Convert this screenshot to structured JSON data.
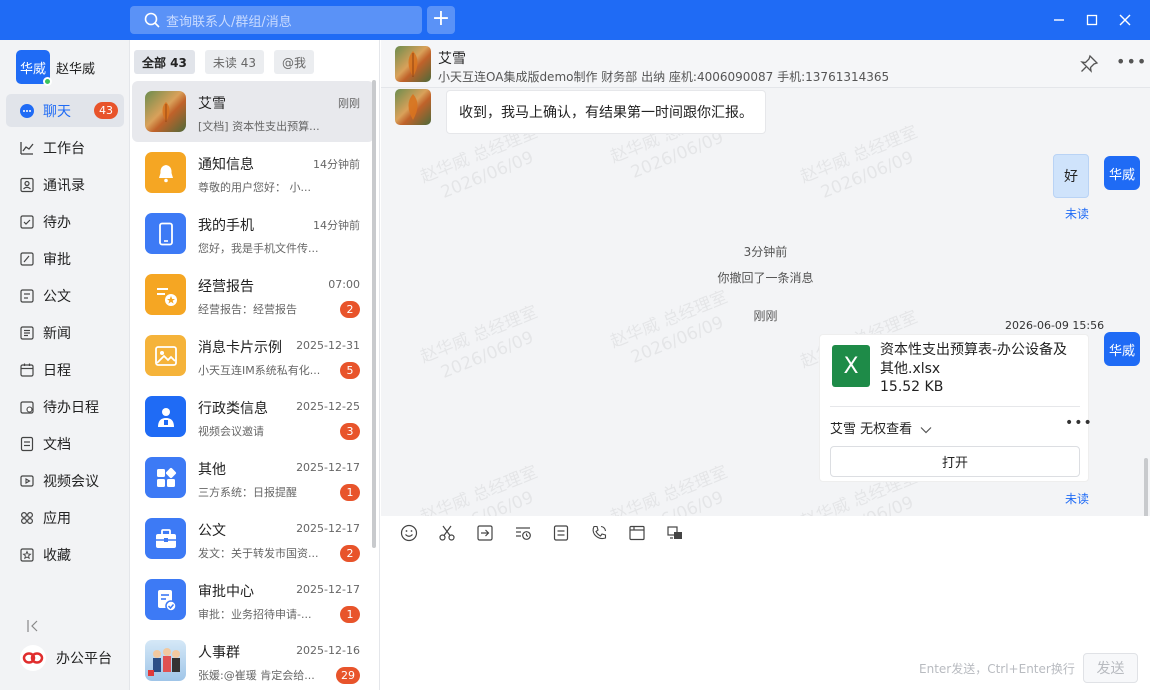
{
  "titlebar": {
    "search_placeholder": "查询联系人/群组/消息",
    "add_label": "+"
  },
  "user": {
    "avatar_text": "华威",
    "name": "赵华威"
  },
  "nav": {
    "items": [
      {
        "label": "聊天",
        "badge": "43",
        "icon": "chat-icon"
      },
      {
        "label": "工作台",
        "icon": "workbench-icon"
      },
      {
        "label": "通讯录",
        "icon": "contacts-icon"
      },
      {
        "label": "待办",
        "icon": "todo-icon"
      },
      {
        "label": "审批",
        "icon": "approval-icon"
      },
      {
        "label": "公文",
        "icon": "document-icon"
      },
      {
        "label": "新闻",
        "icon": "news-icon"
      },
      {
        "label": "日程",
        "icon": "calendar-icon"
      },
      {
        "label": "待办日程",
        "icon": "todo-calendar-icon"
      },
      {
        "label": "文档",
        "icon": "docs-icon"
      },
      {
        "label": "视频会议",
        "icon": "video-icon"
      },
      {
        "label": "应用",
        "icon": "apps-icon"
      },
      {
        "label": "收藏",
        "icon": "star-icon"
      }
    ],
    "platform_label": "办公平台"
  },
  "tabs": [
    {
      "label": "全部 43"
    },
    {
      "label": "未读 43"
    },
    {
      "label": "@我"
    }
  ],
  "conversations": [
    {
      "name": "艾雪",
      "time": "刚刚",
      "preview": "[文档] 资本性支出预算...",
      "badge": "",
      "icon": "leaf-photo-avatar",
      "color": "#c87a2a"
    },
    {
      "name": "通知信息",
      "time": "14分钟前",
      "preview": "尊敬的用户您好：  小...",
      "badge": "",
      "icon": "bell-icon",
      "color": "#f5a623"
    },
    {
      "name": "我的手机",
      "time": "14分钟前",
      "preview": "您好，我是手机文件传...",
      "badge": "",
      "icon": "phone-icon",
      "color": "#3d7af5"
    },
    {
      "name": "经营报告",
      "time": "07:00",
      "preview": "经营报告：经营报告",
      "badge": "2",
      "icon": "report-icon",
      "color": "#f5a623"
    },
    {
      "name": "消息卡片示例",
      "time": "2025-12-31",
      "preview": "小天互连IM系统私有化...",
      "badge": "5",
      "icon": "image-card-icon",
      "color": "#f5b33a"
    },
    {
      "name": "行政类信息",
      "time": "2025-12-25",
      "preview": "视频会议邀请",
      "badge": "3",
      "icon": "meeting-icon",
      "color": "#1f6bf5"
    },
    {
      "name": "其他",
      "time": "2025-12-17",
      "preview": "三方系统：日报提醒",
      "badge": "1",
      "icon": "grid-icon",
      "color": "#3d7af5"
    },
    {
      "name": "公文",
      "time": "2025-12-17",
      "preview": "发文：关于转发市国资...",
      "badge": "2",
      "icon": "briefcase-icon",
      "color": "#3d7af5"
    },
    {
      "name": "审批中心",
      "time": "2025-12-17",
      "preview": "审批：业务招待申请-...",
      "badge": "1",
      "icon": "approval-center-icon",
      "color": "#3d7af5"
    },
    {
      "name": "人事群",
      "time": "2025-12-16",
      "preview": "张媛:@崔瑗 肯定会给...",
      "badge": "29",
      "icon": "group-photo-avatar",
      "color": "#7fb3e0"
    }
  ],
  "chat": {
    "name": "艾雪",
    "info": "小天互连OA集成版demo制作 财务部 出纳 座机:4006090087 手机:13761314365",
    "watermark_name": "赵华威 总经理室",
    "watermark_date": "2026/06/09",
    "incoming_text": "收到，我马上确认，有结果第一时间跟你汇报。",
    "my_avatar_text": "华威",
    "outgoing_text": "好",
    "unread_label": "未读",
    "sys1": "3分钟前",
    "sys2": "你撤回了一条消息",
    "sys3": "刚刚",
    "file_time": "2026-06-09 15:56",
    "file_name": "资本性支出预算表-办公设备及其他.xlsx",
    "file_size": "15.52 KB",
    "file_icon_text": "X",
    "permission": "艾雪 无权查看",
    "open_label": "打开",
    "input_hint": "Enter发送，Ctrl+Enter换行",
    "send_label": "发送"
  },
  "colors": {
    "brand": "#1f6bf5",
    "badge": "#e8542b",
    "excel": "#1e8b48"
  }
}
